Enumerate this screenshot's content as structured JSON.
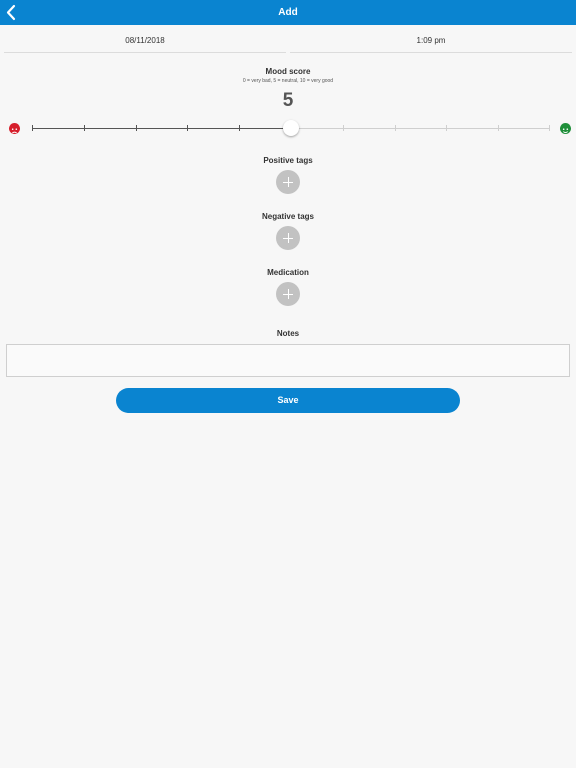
{
  "header": {
    "title": "Add",
    "back_icon": "chevron-left-icon",
    "color": "#0a84d0"
  },
  "entry": {
    "date": "08/11/2018",
    "time": "1:09 pm"
  },
  "mood": {
    "label": "Mood score",
    "hint": "0 = very bad, 5 = neutral, 10 = very good",
    "value": 5,
    "min": 0,
    "max": 10,
    "display": "5",
    "sad_icon": "sad-face-icon",
    "happy_icon": "happy-face-icon",
    "sad_color": "#d61f2c",
    "happy_color": "#1f8f3a"
  },
  "sections": {
    "positive_tags": "Positive tags",
    "negative_tags": "Negative tags",
    "medication": "Medication",
    "notes": "Notes",
    "add_icon": "plus-icon"
  },
  "actions": {
    "save": "Save"
  }
}
